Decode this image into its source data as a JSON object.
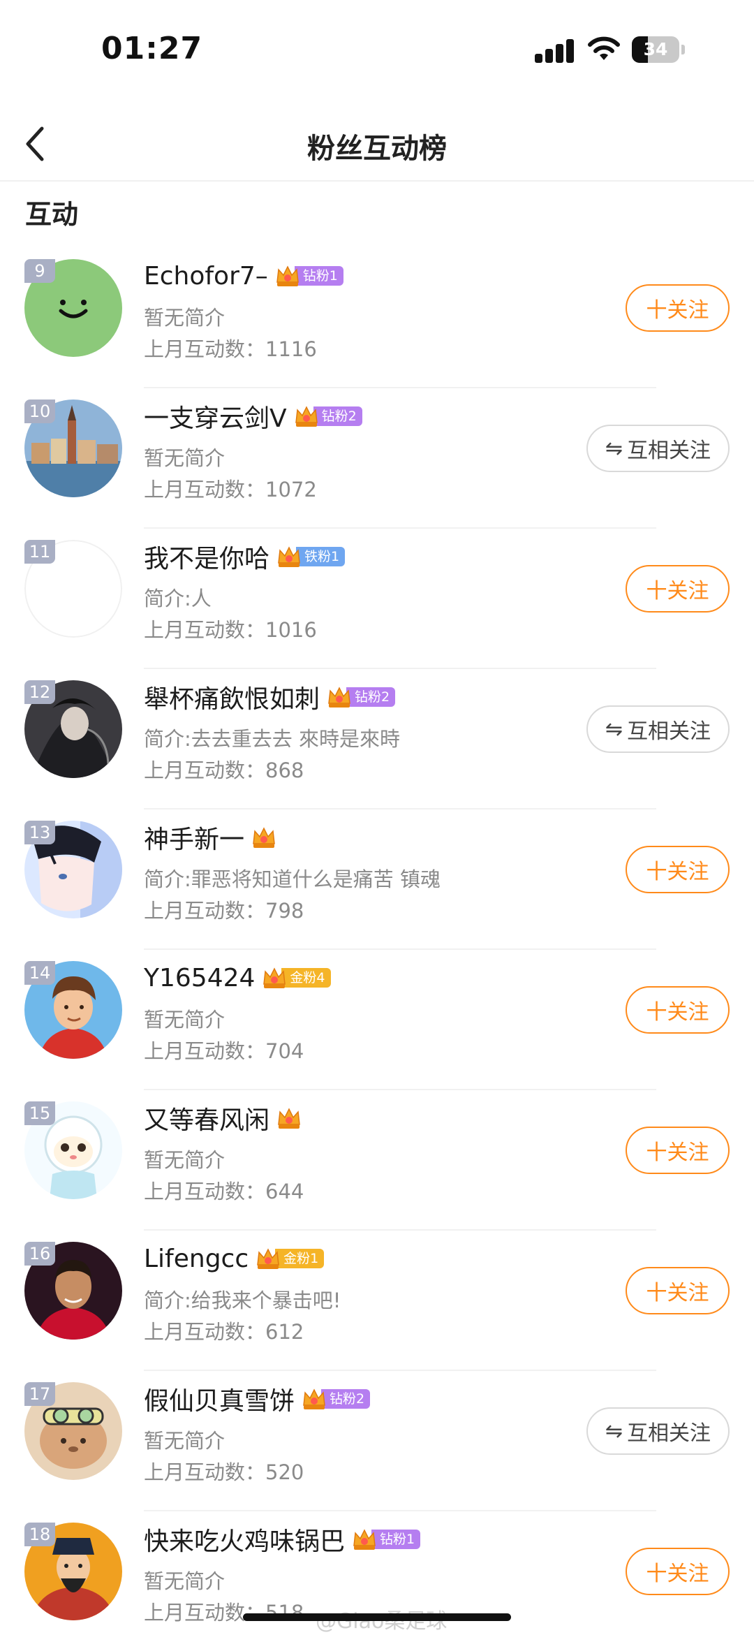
{
  "status_bar": {
    "time": "01:27",
    "battery": "34",
    "battery_level": 0.34
  },
  "nav": {
    "title": "粉丝互动榜"
  },
  "section_title": "互动",
  "follow_label": "十关注",
  "mutual_label": "互相关注",
  "fans": [
    {
      "rank": "9",
      "name": "Echofor7–",
      "badge": "钻粉1",
      "badge_color": "#b57ef0",
      "bio": "暂无简介",
      "count": "上月互动数：1116",
      "button": "follow",
      "avatar": "smile-green"
    },
    {
      "rank": "10",
      "name": "一支穿云剑V",
      "badge": "钻粉2",
      "badge_color": "#b57ef0",
      "bio": "暂无简介",
      "count": "上月互动数：1072",
      "button": "mutual",
      "avatar": "city"
    },
    {
      "rank": "11",
      "name": "我不是你哈",
      "badge": "铁粉1",
      "badge_color": "#6fa6f0",
      "bio": "简介:人",
      "count": "上月互动数：1016",
      "button": "follow",
      "avatar": "blank"
    },
    {
      "rank": "12",
      "name": "舉杯痛飲恨如刺",
      "badge": "钻粉2",
      "badge_color": "#b57ef0",
      "bio": "简介:去去重去去 來時是來時",
      "count": "上月互动数：868",
      "button": "mutual",
      "avatar": "dark"
    },
    {
      "rank": "13",
      "name": "神手新一",
      "badge": "",
      "badge_color": "",
      "bio": "简介:罪恶将知道什么是痛苦 镇魂",
      "count": "上月互动数：798",
      "button": "follow",
      "avatar": "anime"
    },
    {
      "rank": "14",
      "name": "Y165424",
      "badge": "金粉4",
      "badge_color": "#f5b427",
      "bio": "暂无简介",
      "count": "上月互动数：704",
      "button": "follow",
      "avatar": "boy"
    },
    {
      "rank": "15",
      "name": "又等春风闲",
      "badge": "",
      "badge_color": "",
      "bio": "暂无简介",
      "count": "上月互动数：644",
      "button": "follow",
      "avatar": "sheep"
    },
    {
      "rank": "16",
      "name": "Lifengcc",
      "badge": "金粉1",
      "badge_color": "#f5b427",
      "bio": "简介:给我来个暴击吧!",
      "count": "上月互动数：612",
      "button": "follow",
      "avatar": "player"
    },
    {
      "rank": "17",
      "name": "假仙贝真雪饼",
      "badge": "钻粉2",
      "badge_color": "#b57ef0",
      "bio": "暂无简介",
      "count": "上月互动数：520",
      "button": "mutual",
      "avatar": "bear"
    },
    {
      "rank": "18",
      "name": "快来吃火鸡味锅巴",
      "badge": "钻粉1",
      "badge_color": "#b57ef0",
      "bio": "暂无简介",
      "count": "上月互动数：518",
      "button": "follow",
      "avatar": "god"
    }
  ],
  "watermark": "@Giao桑足球",
  "colors": {
    "accent": "#ff8a1a",
    "rank_bg": "#a9afc4",
    "muted_text": "#8a8a8a"
  }
}
